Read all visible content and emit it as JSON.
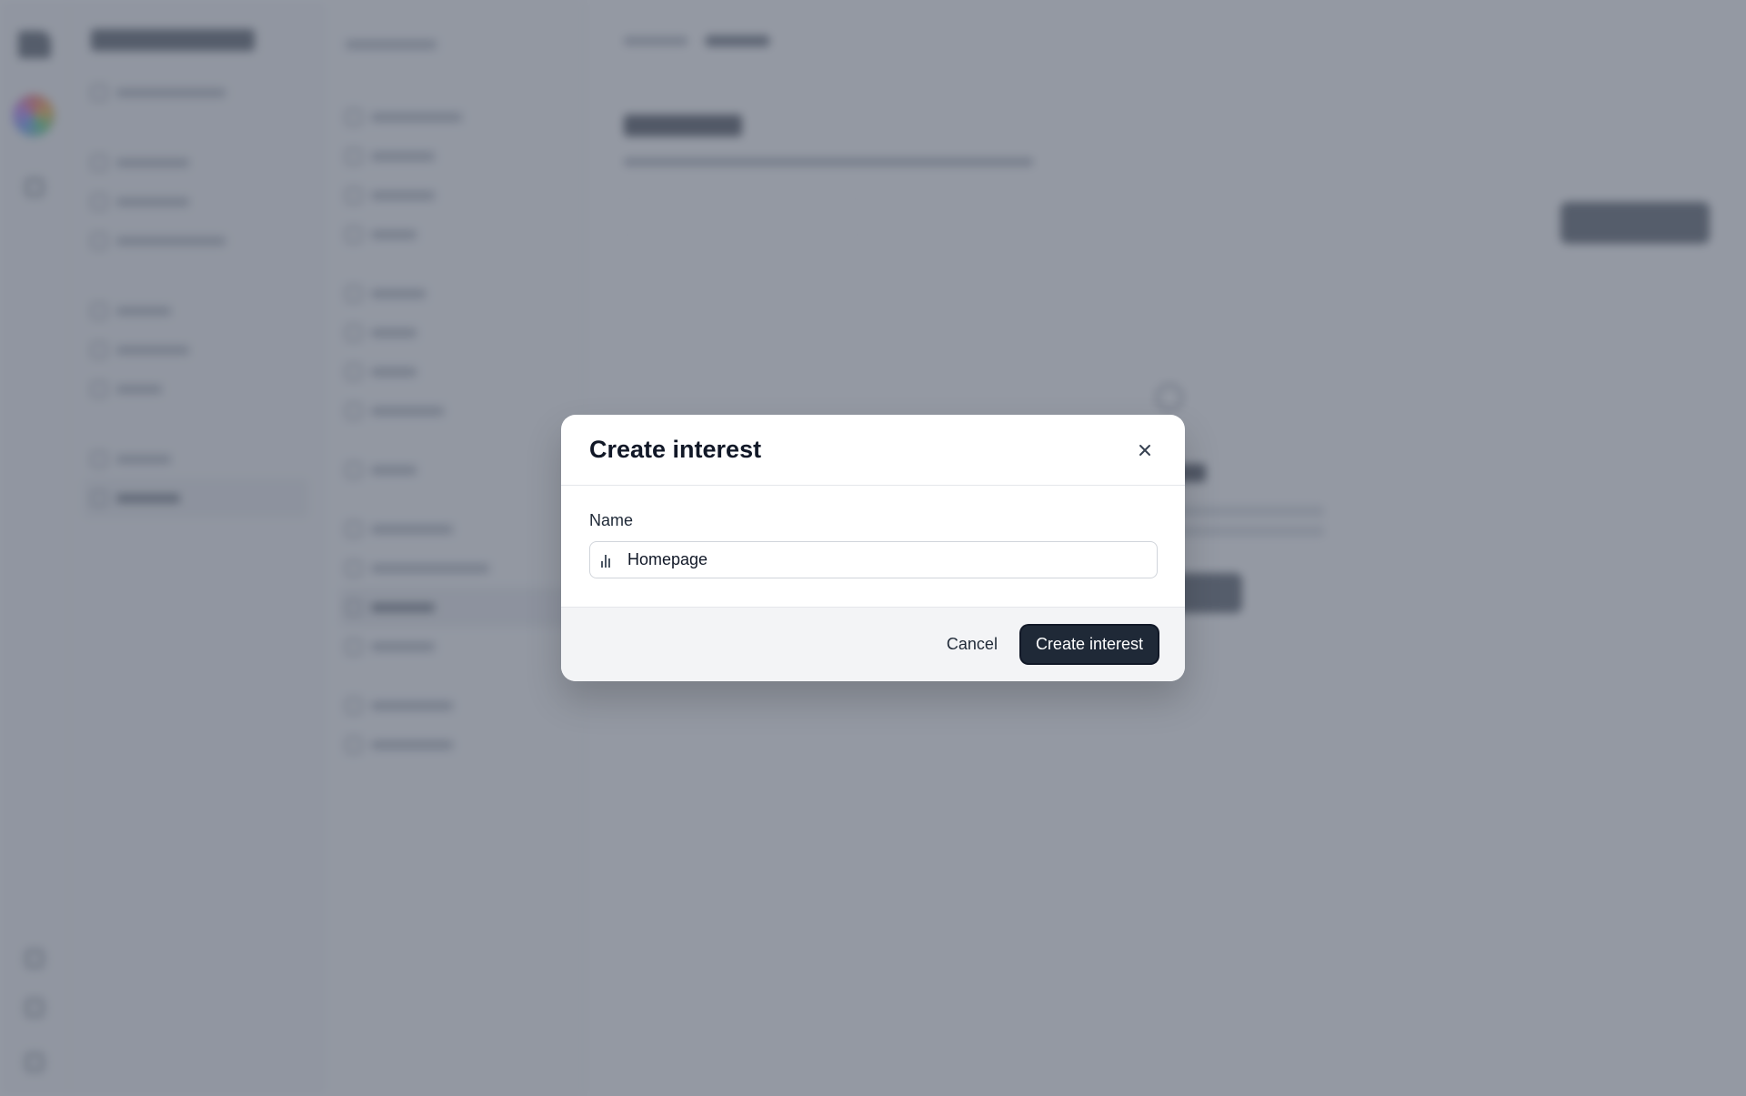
{
  "modal": {
    "title": "Create interest",
    "name_label": "Name",
    "name_value": "Homepage",
    "cancel_label": "Cancel",
    "submit_label": "Create interest",
    "close_icon": "×"
  },
  "colors": {
    "overlay": "#6b7280",
    "primary_button": "#1f2937",
    "footer_bg": "#f3f4f6"
  }
}
